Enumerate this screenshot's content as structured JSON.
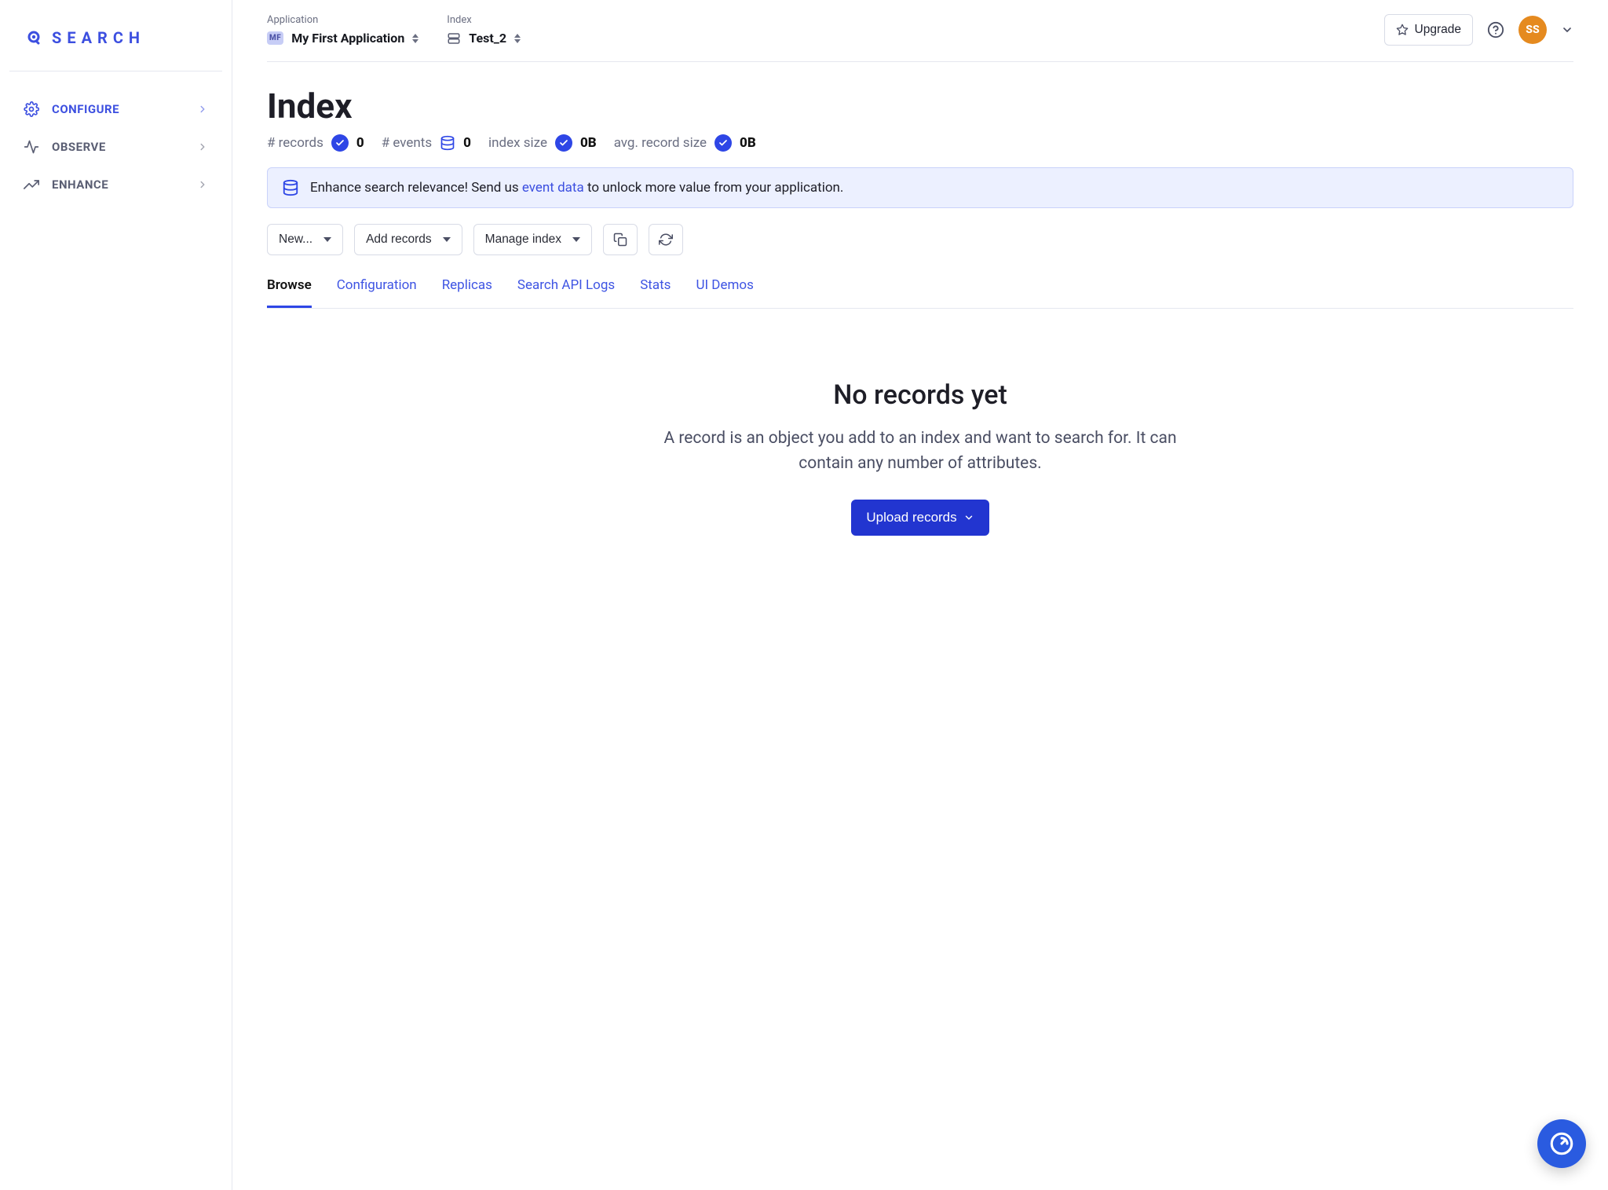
{
  "brand": {
    "name": "SEARCH"
  },
  "sidebar": {
    "items": [
      {
        "label": "CONFIGURE",
        "icon": "gear-icon",
        "active": true
      },
      {
        "label": "OBSERVE",
        "icon": "activity-icon",
        "active": false
      },
      {
        "label": "ENHANCE",
        "icon": "trend-up-icon",
        "active": false
      }
    ]
  },
  "header": {
    "application_label": "Application",
    "application_value": "My First Application",
    "application_chip": "MF",
    "index_label": "Index",
    "index_value": "Test_2",
    "upgrade_label": "Upgrade",
    "avatar_initials": "SS"
  },
  "page": {
    "title": "Index",
    "stats": {
      "records_label": "# records",
      "records_value": "0",
      "events_label": "# events",
      "events_value": "0",
      "size_label": "index size",
      "size_value": "0B",
      "avg_label": "avg. record size",
      "avg_value": "0B"
    },
    "banner": {
      "prefix": "Enhance search relevance! Send us ",
      "link_text": "event data",
      "suffix": " to unlock more value from your application."
    },
    "toolbar": {
      "new_label": "New...",
      "add_label": "Add records",
      "manage_label": "Manage index"
    },
    "tabs": [
      {
        "label": "Browse",
        "active": true
      },
      {
        "label": "Configuration",
        "active": false
      },
      {
        "label": "Replicas",
        "active": false
      },
      {
        "label": "Search API Logs",
        "active": false
      },
      {
        "label": "Stats",
        "active": false
      },
      {
        "label": "UI Demos",
        "active": false
      }
    ],
    "empty": {
      "title": "No records yet",
      "description": "A record is an object you add to an index and want to search for. It can contain any number of attributes.",
      "cta_label": "Upload records"
    }
  }
}
